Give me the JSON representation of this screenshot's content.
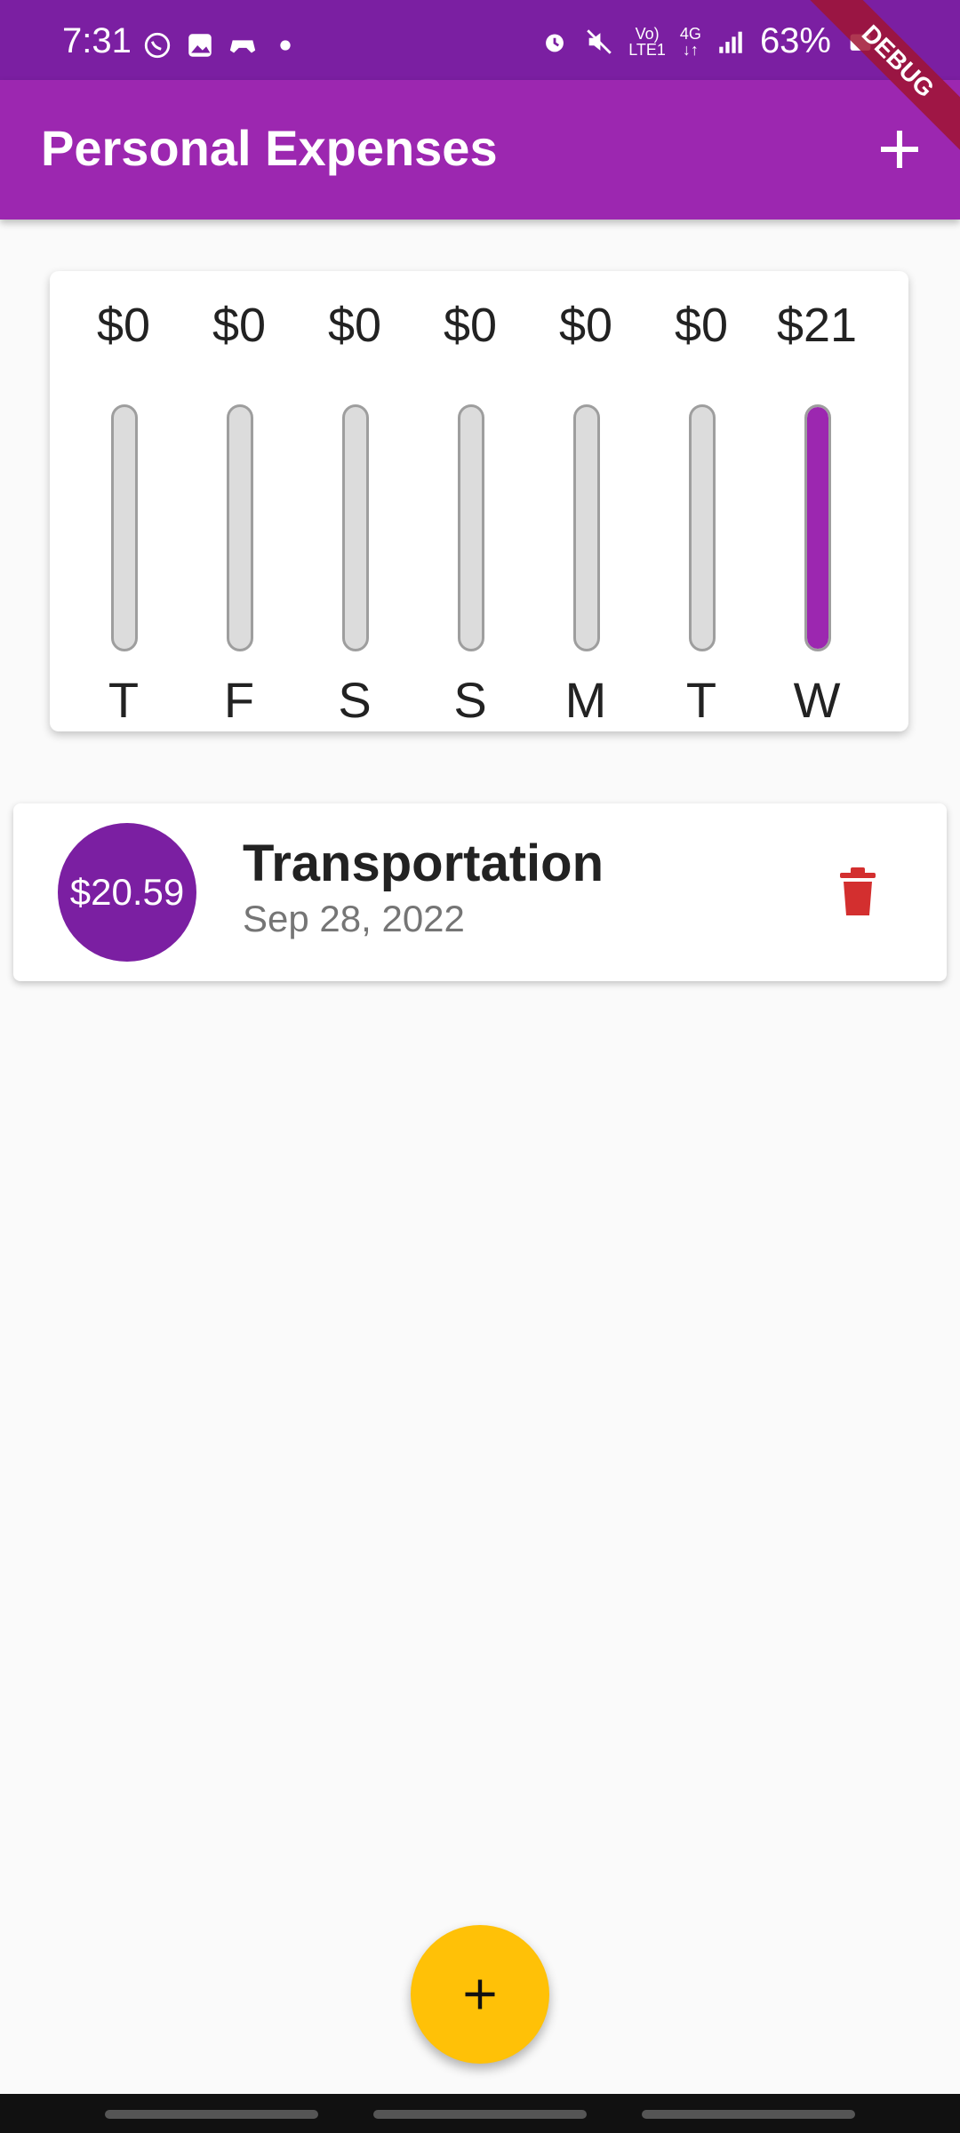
{
  "status_bar": {
    "time": "7:31",
    "left_icons": [
      "whatsapp-icon",
      "gallery-icon",
      "game-icon",
      "notification-dot-icon"
    ],
    "network_top": "Vo)",
    "network_bottom": "LTE1",
    "network_type": "4G",
    "battery": "63%",
    "right_icons": [
      "alarm-icon",
      "mute-icon",
      "volte-icon",
      "4g-icon",
      "signal-icon",
      "battery-icon"
    ]
  },
  "debug_banner": "DEBUG",
  "app_bar": {
    "title": "Personal Expenses",
    "action_icon": "add-icon"
  },
  "colors": {
    "primary": "#9c27b0",
    "primary_dark": "#7b1fa2",
    "accent": "#ffc107",
    "delete": "#d32f2f"
  },
  "chart": {
    "days": [
      {
        "label": "T",
        "amount": "$0",
        "fraction": 0
      },
      {
        "label": "F",
        "amount": "$0",
        "fraction": 0
      },
      {
        "label": "S",
        "amount": "$0",
        "fraction": 0
      },
      {
        "label": "S",
        "amount": "$0",
        "fraction": 0
      },
      {
        "label": "M",
        "amount": "$0",
        "fraction": 0
      },
      {
        "label": "T",
        "amount": "$0",
        "fraction": 0
      },
      {
        "label": "W",
        "amount": "$21",
        "fraction": 1
      }
    ]
  },
  "transactions": [
    {
      "amount": "$20.59",
      "title": "Transportation",
      "date": "Sep 28, 2022",
      "action_icon": "trash-icon"
    }
  ],
  "fab": {
    "icon": "add-icon"
  }
}
